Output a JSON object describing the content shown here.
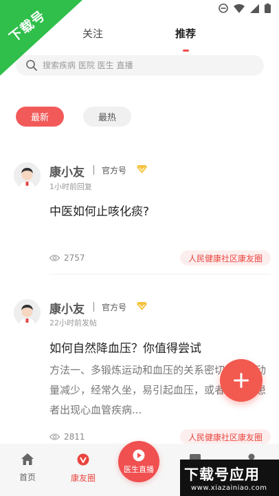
{
  "watermark": {
    "corner_text": "下载号",
    "bottom_main": "下载号应用",
    "bottom_url": "www.xiazainiao.com"
  },
  "top_tabs": [
    {
      "label": "关注",
      "active": false
    },
    {
      "label": "推荐",
      "active": true
    }
  ],
  "search": {
    "placeholder": "搜索疾病 医院 医生 直播"
  },
  "filters": [
    {
      "label": "最新",
      "active": true
    },
    {
      "label": "最热",
      "active": false
    }
  ],
  "posts": [
    {
      "author": "康小友",
      "badge": "官方号",
      "time": "1小时前回复",
      "title": "中医如何止咳化痰?",
      "excerpt": "",
      "views": "2757",
      "community": "人民健康社区康友圈"
    },
    {
      "author": "康小友",
      "badge": "官方号",
      "time": "22小时前发帖",
      "title": "如何自然降血压？你值得尝试",
      "excerpt": "方法一、多锻炼运动和血压的关系密切，当运动量减少，经常久坐，易引起血压，或者高血压患者出现心血管疾病...",
      "views": "2811",
      "community": "人民健康社区康友圈"
    }
  ],
  "bottom_nav": {
    "home": "首页",
    "friends": "康友圈",
    "live": "医生直播"
  },
  "colors": {
    "accent": "#f04a4a",
    "watermark_green": "#2fbf4a"
  }
}
